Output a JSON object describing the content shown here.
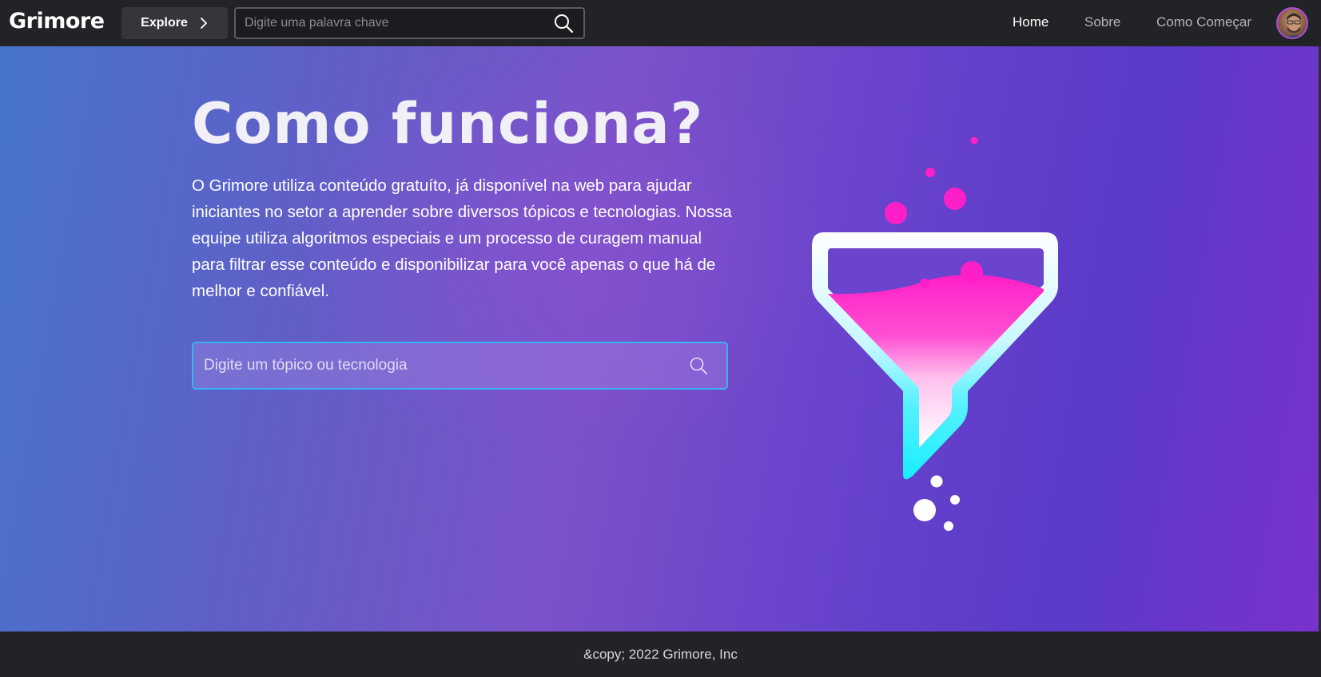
{
  "header": {
    "logo": "Grimore",
    "explore_label": "Explore",
    "search_placeholder": "Digite uma palavra chave",
    "nav": {
      "home": "Home",
      "about": "Sobre",
      "getting_started": "Como Começar"
    }
  },
  "hero": {
    "title": "Como funciona?",
    "description": "O Grimore utiliza conteúdo gratuíto, já disponível na web para ajudar iniciantes no setor a aprender sobre diversos tópicos e tecnologias. Nossa equipe utiliza algoritmos especiais e um processo de curagem manual para filtrar esse conteúdo e disponibilizar para você apenas o que há de melhor e confiável.",
    "search_placeholder": "Digite um tópico ou tecnologia"
  },
  "footer": {
    "copyright": "&copy; 2022 Grimore, Inc"
  },
  "colors": {
    "topbar": "#212327",
    "accent_pink": "#ff1fc8",
    "accent_cyan": "#18eefc",
    "search_border": "#39b3f0"
  },
  "icons": {
    "explore": "chevron-right-icon",
    "search": "search-icon",
    "illustration": "funnel-illustration"
  }
}
